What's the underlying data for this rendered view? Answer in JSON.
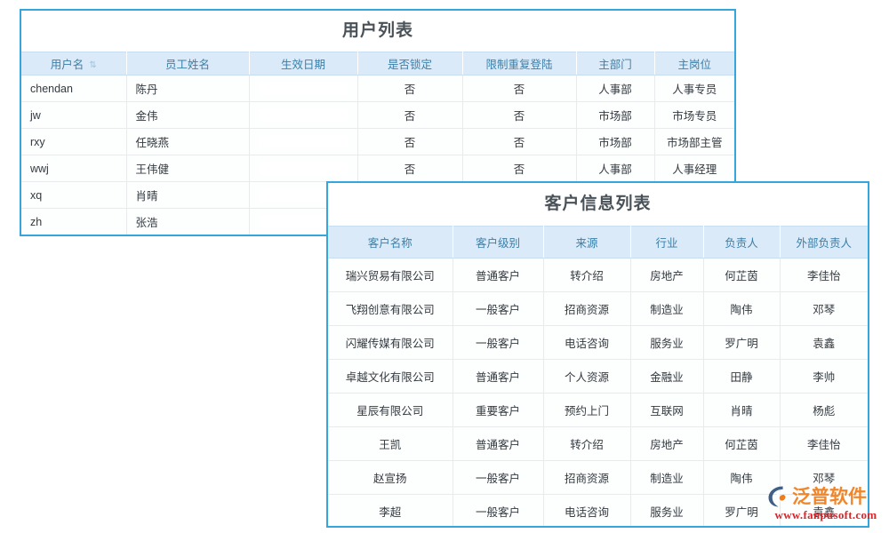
{
  "colors": {
    "panel_border": "#34a5dd",
    "header_bg": "#dbeaf8",
    "header_text": "#3b7fa8",
    "title_text": "#4a5259",
    "link": "#2f7fd0",
    "watermark_brand": "#ef7c1b",
    "watermark_url": "#d8262b"
  },
  "user_panel": {
    "title": "用户列表",
    "sort_glyph": "⇅",
    "columns": [
      "用户名",
      "员工姓名",
      "生效日期",
      "是否锁定",
      "限制重复登陆",
      "主部门",
      "主岗位"
    ],
    "rows": [
      {
        "username": "chendan",
        "name": "陈丹",
        "effective_date": "",
        "locked": "否",
        "limit_repeat_login": "否",
        "main_dept": "人事部",
        "main_post": "人事专员"
      },
      {
        "username": "jw",
        "name": "金伟",
        "effective_date": "",
        "locked": "否",
        "limit_repeat_login": "否",
        "main_dept": "市场部",
        "main_post": "市场专员"
      },
      {
        "username": "rxy",
        "name": "任晓燕",
        "effective_date": "",
        "locked": "否",
        "limit_repeat_login": "否",
        "main_dept": "市场部",
        "main_post": "市场部主管"
      },
      {
        "username": "wwj",
        "name": "王伟健",
        "effective_date": "",
        "locked": "否",
        "limit_repeat_login": "否",
        "main_dept": "人事部",
        "main_post": "人事经理"
      },
      {
        "username": "xq",
        "name": "肖晴",
        "effective_date": "",
        "locked": "",
        "limit_repeat_login": "",
        "main_dept": "",
        "main_post": ""
      },
      {
        "username": "zh",
        "name": "张浩",
        "effective_date": "",
        "locked": "",
        "limit_repeat_login": "",
        "main_dept": "",
        "main_post": ""
      }
    ]
  },
  "customer_panel": {
    "title": "客户信息列表",
    "columns": [
      "客户名称",
      "客户级别",
      "来源",
      "行业",
      "负责人",
      "外部负责人"
    ],
    "rows": [
      {
        "name": "瑞兴贸易有限公司",
        "level": "普通客户",
        "source": "转介绍",
        "industry": "房地产",
        "owner": "何芷茵",
        "external_owner": "李佳怡"
      },
      {
        "name": "飞翔创意有限公司",
        "level": "一般客户",
        "source": "招商资源",
        "industry": "制造业",
        "owner": "陶伟",
        "external_owner": "邓琴"
      },
      {
        "name": "闪耀传媒有限公司",
        "level": "一般客户",
        "source": "电话咨询",
        "industry": "服务业",
        "owner": "罗广明",
        "external_owner": "袁鑫"
      },
      {
        "name": "卓越文化有限公司",
        "level": "普通客户",
        "source": "个人资源",
        "industry": "金融业",
        "owner": "田静",
        "external_owner": "李帅"
      },
      {
        "name": "星辰有限公司",
        "level": "重要客户",
        "source": "预约上门",
        "industry": "互联网",
        "owner": "肖晴",
        "external_owner": "杨彪"
      },
      {
        "name": "王凯",
        "level": "普通客户",
        "source": "转介绍",
        "industry": "房地产",
        "owner": "何芷茵",
        "external_owner": "李佳怡"
      },
      {
        "name": "赵宣扬",
        "level": "一般客户",
        "source": "招商资源",
        "industry": "制造业",
        "owner": "陶伟",
        "external_owner": "邓琴"
      },
      {
        "name": "李超",
        "level": "一般客户",
        "source": "电话咨询",
        "industry": "服务业",
        "owner": "罗广明",
        "external_owner": "袁鑫"
      }
    ]
  },
  "watermark": {
    "brand": "泛普软件",
    "url": "www.fanpusoft.com"
  }
}
